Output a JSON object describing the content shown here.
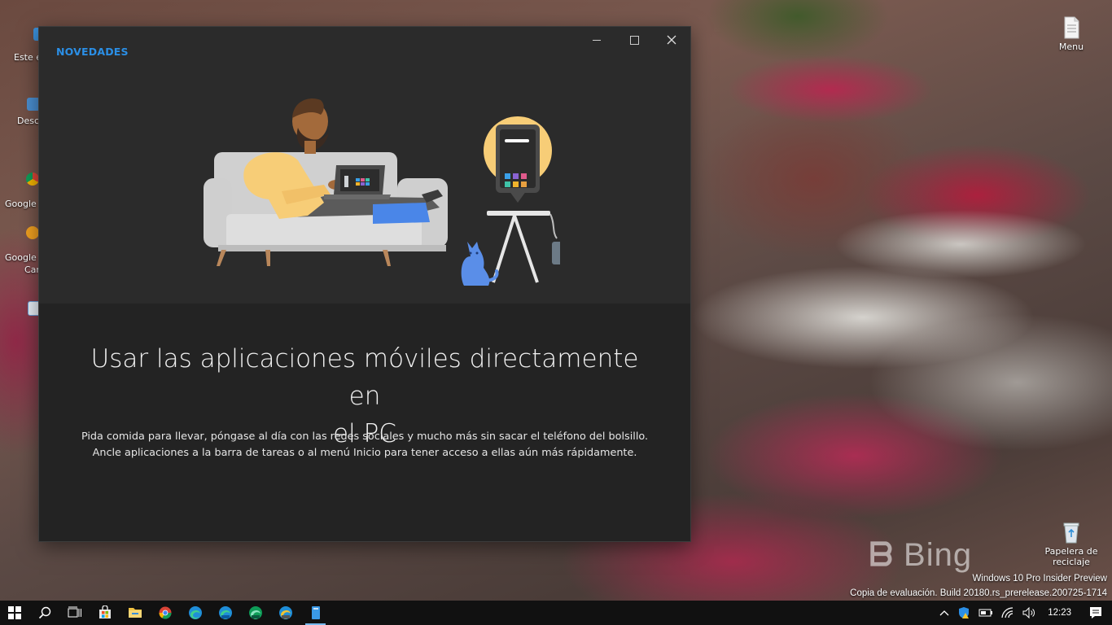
{
  "desktop": {
    "left_icons": [
      {
        "label": "Este e"
      },
      {
        "label": "Desc"
      },
      {
        "label": "Google"
      },
      {
        "label": "Google"
      },
      {
        "label": "Car"
      }
    ],
    "menu_icon": {
      "label": "Menu"
    },
    "recycle_bin": {
      "label_line1": "Papelera de",
      "label_line2": "reciclaje"
    },
    "watermark": {
      "brand": "Bing",
      "line1": "Windows 10 Pro Insider Preview",
      "line2": "Copia de evaluación. Build 20180.rs_prerelease.200725-1714"
    }
  },
  "window": {
    "section_label": "NOVEDADES",
    "headline_line1": "Usar las aplicaciones móviles directamente en",
    "headline_line2": "el PC",
    "body_line1": "Pida comida para llevar, póngase al día con las redes sociales y mucho más sin sacar el teléfono del bolsillo.",
    "body_line2": "Ancle aplicaciones a la barra de tareas o al menú Inicio para tener acceso a ellas aún más rápidamente.",
    "controls": {
      "minimize": "—",
      "maximize": "☐",
      "close": "✕"
    }
  },
  "taskbar": {
    "clock": "12:23",
    "accent": "#76b9ed"
  }
}
